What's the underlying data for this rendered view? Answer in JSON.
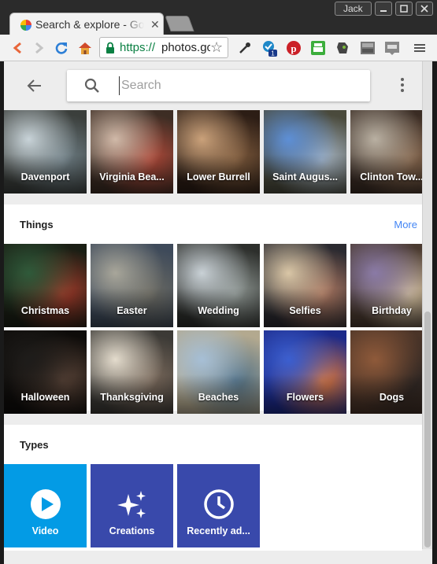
{
  "window": {
    "user": "Jack"
  },
  "tab": {
    "title": "Search & explore - Google Photos"
  },
  "toolbar": {
    "url_scheme": "https://",
    "url_host": "photos.google.com",
    "extension_badge": "1"
  },
  "search": {
    "placeholder": "Search",
    "value": ""
  },
  "places": {
    "items": [
      {
        "label": "Davenport",
        "colors": [
          "#c8d3d8",
          "#6f7f86",
          "#3b3f3c"
        ]
      },
      {
        "label": "Virginia Bea...",
        "colors": [
          "#d0b9a8",
          "#b44a3a",
          "#3d2d24"
        ]
      },
      {
        "label": "Lower Burrell",
        "colors": [
          "#caa17a",
          "#7d5a3c",
          "#2c1d15"
        ]
      },
      {
        "label": "Saint Augus...",
        "colors": [
          "#5d8fd6",
          "#a9b8c7",
          "#4a4a3c"
        ]
      },
      {
        "label": "Clinton Tow...",
        "colors": [
          "#b9b0a2",
          "#8a6a50",
          "#3a2c24"
        ]
      }
    ]
  },
  "things": {
    "title": "Things",
    "more_label": "More",
    "items": [
      {
        "label": "Christmas",
        "colors": [
          "#2f5a3a",
          "#a33a2a",
          "#1a1e14"
        ]
      },
      {
        "label": "Easter",
        "colors": [
          "#a8a69a",
          "#6b6a62",
          "#3e4a5a"
        ]
      },
      {
        "label": "Wedding",
        "colors": [
          "#c9d1d6",
          "#8e9692",
          "#2d2f2c"
        ]
      },
      {
        "label": "Selfies",
        "colors": [
          "#d9c6a6",
          "#b07a63",
          "#2b2a30"
        ]
      },
      {
        "label": "Birthday",
        "colors": [
          "#8a7aa6",
          "#d6c3a2",
          "#4a3a30"
        ]
      },
      {
        "label": "Halloween",
        "colors": [
          "#1e1c1a",
          "#5a4438",
          "#0e0c0a"
        ]
      },
      {
        "label": "Thanksgiving",
        "colors": [
          "#e4dccd",
          "#7b6a5c",
          "#3c3a36"
        ]
      },
      {
        "label": "Beaches",
        "colors": [
          "#a6bfd6",
          "#4e6f86",
          "#b3a98f"
        ]
      },
      {
        "label": "Flowers",
        "colors": [
          "#3b5fd0",
          "#e37a3a",
          "#1c2a8a"
        ]
      },
      {
        "label": "Dogs",
        "colors": [
          "#8f5a3a",
          "#2a2422",
          "#4a3428"
        ]
      }
    ]
  },
  "types": {
    "title": "Types",
    "items": [
      {
        "label": "Video",
        "color": "#039be5",
        "icon": "play-circle-icon"
      },
      {
        "label": "Creations",
        "color": "#3949ab",
        "icon": "sparkle-icon"
      },
      {
        "label": "Recently ad...",
        "color": "#3949ab",
        "icon": "clock-icon"
      }
    ]
  }
}
